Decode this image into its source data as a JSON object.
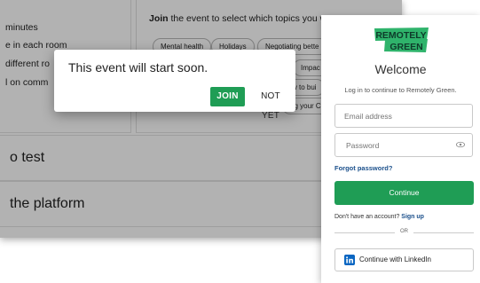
{
  "background": {
    "left_lines": [
      "minutes",
      "e in each room",
      "different ro",
      "l on comm"
    ],
    "join_prompt": {
      "bold": "Join",
      "rest": " the event to select which topics you wo"
    },
    "topic_chips": [
      "Mental health",
      "Holidays",
      "Negotiating bette",
      "Impac",
      "w to bui",
      "ng your C"
    ],
    "rows": [
      "o test",
      "the platform"
    ]
  },
  "dialog": {
    "title": "This event will start soon.",
    "join_label": "JOIN",
    "not_yet_label": "NOT YET"
  },
  "login": {
    "logo_text": [
      "REMOTELY",
      "GREEN"
    ],
    "welcome": "Welcome",
    "subtitle": "Log in to continue to Remotely Green.",
    "email_placeholder": "Email address",
    "password_placeholder": "Password",
    "forgot": "Forgot password?",
    "continue_label": "Continue",
    "no_account": "Don't have an account?",
    "sign_up": "Sign up",
    "or": "OR",
    "linkedin_label": "Continue with LinkedIn"
  },
  "colors": {
    "accent_green": "#1f9d55",
    "link_blue": "#1a4f8b",
    "linkedin_blue": "#0a66c2"
  }
}
